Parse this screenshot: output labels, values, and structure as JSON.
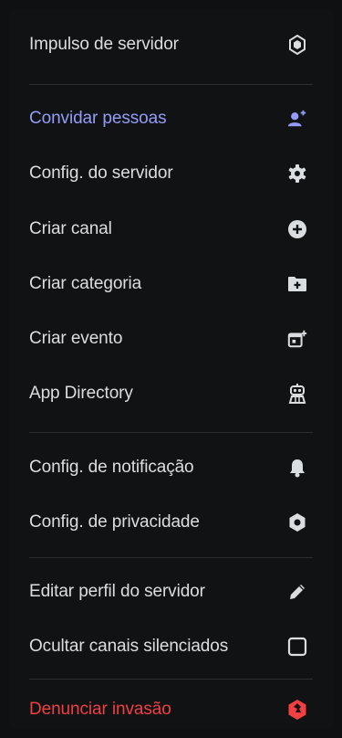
{
  "menu": {
    "items": [
      {
        "label": "Impulso de servidor",
        "icon": "boost-icon"
      },
      {
        "label": "Convidar pessoas",
        "icon": "add-person-icon"
      },
      {
        "label": "Config. do servidor",
        "icon": "gear-icon"
      },
      {
        "label": "Criar canal",
        "icon": "plus-circle-icon"
      },
      {
        "label": "Criar categoria",
        "icon": "folder-plus-icon"
      },
      {
        "label": "Criar evento",
        "icon": "calendar-plus-icon"
      },
      {
        "label": "App Directory",
        "icon": "robot-icon"
      },
      {
        "label": "Config. de notificação",
        "icon": "bell-icon"
      },
      {
        "label": "Config. de privacidade",
        "icon": "shield-icon"
      },
      {
        "label": "Editar perfil do servidor",
        "icon": "pencil-icon"
      },
      {
        "label": "Ocultar canais silenciados",
        "icon": "checkbox-icon"
      },
      {
        "label": "Denunciar invasão",
        "icon": "report-shield-icon"
      }
    ]
  },
  "colors": {
    "background": "#111214",
    "text": "#dbdee1",
    "accent": "#949cf7",
    "danger": "#f23f42",
    "divider": "#2b2d31"
  }
}
